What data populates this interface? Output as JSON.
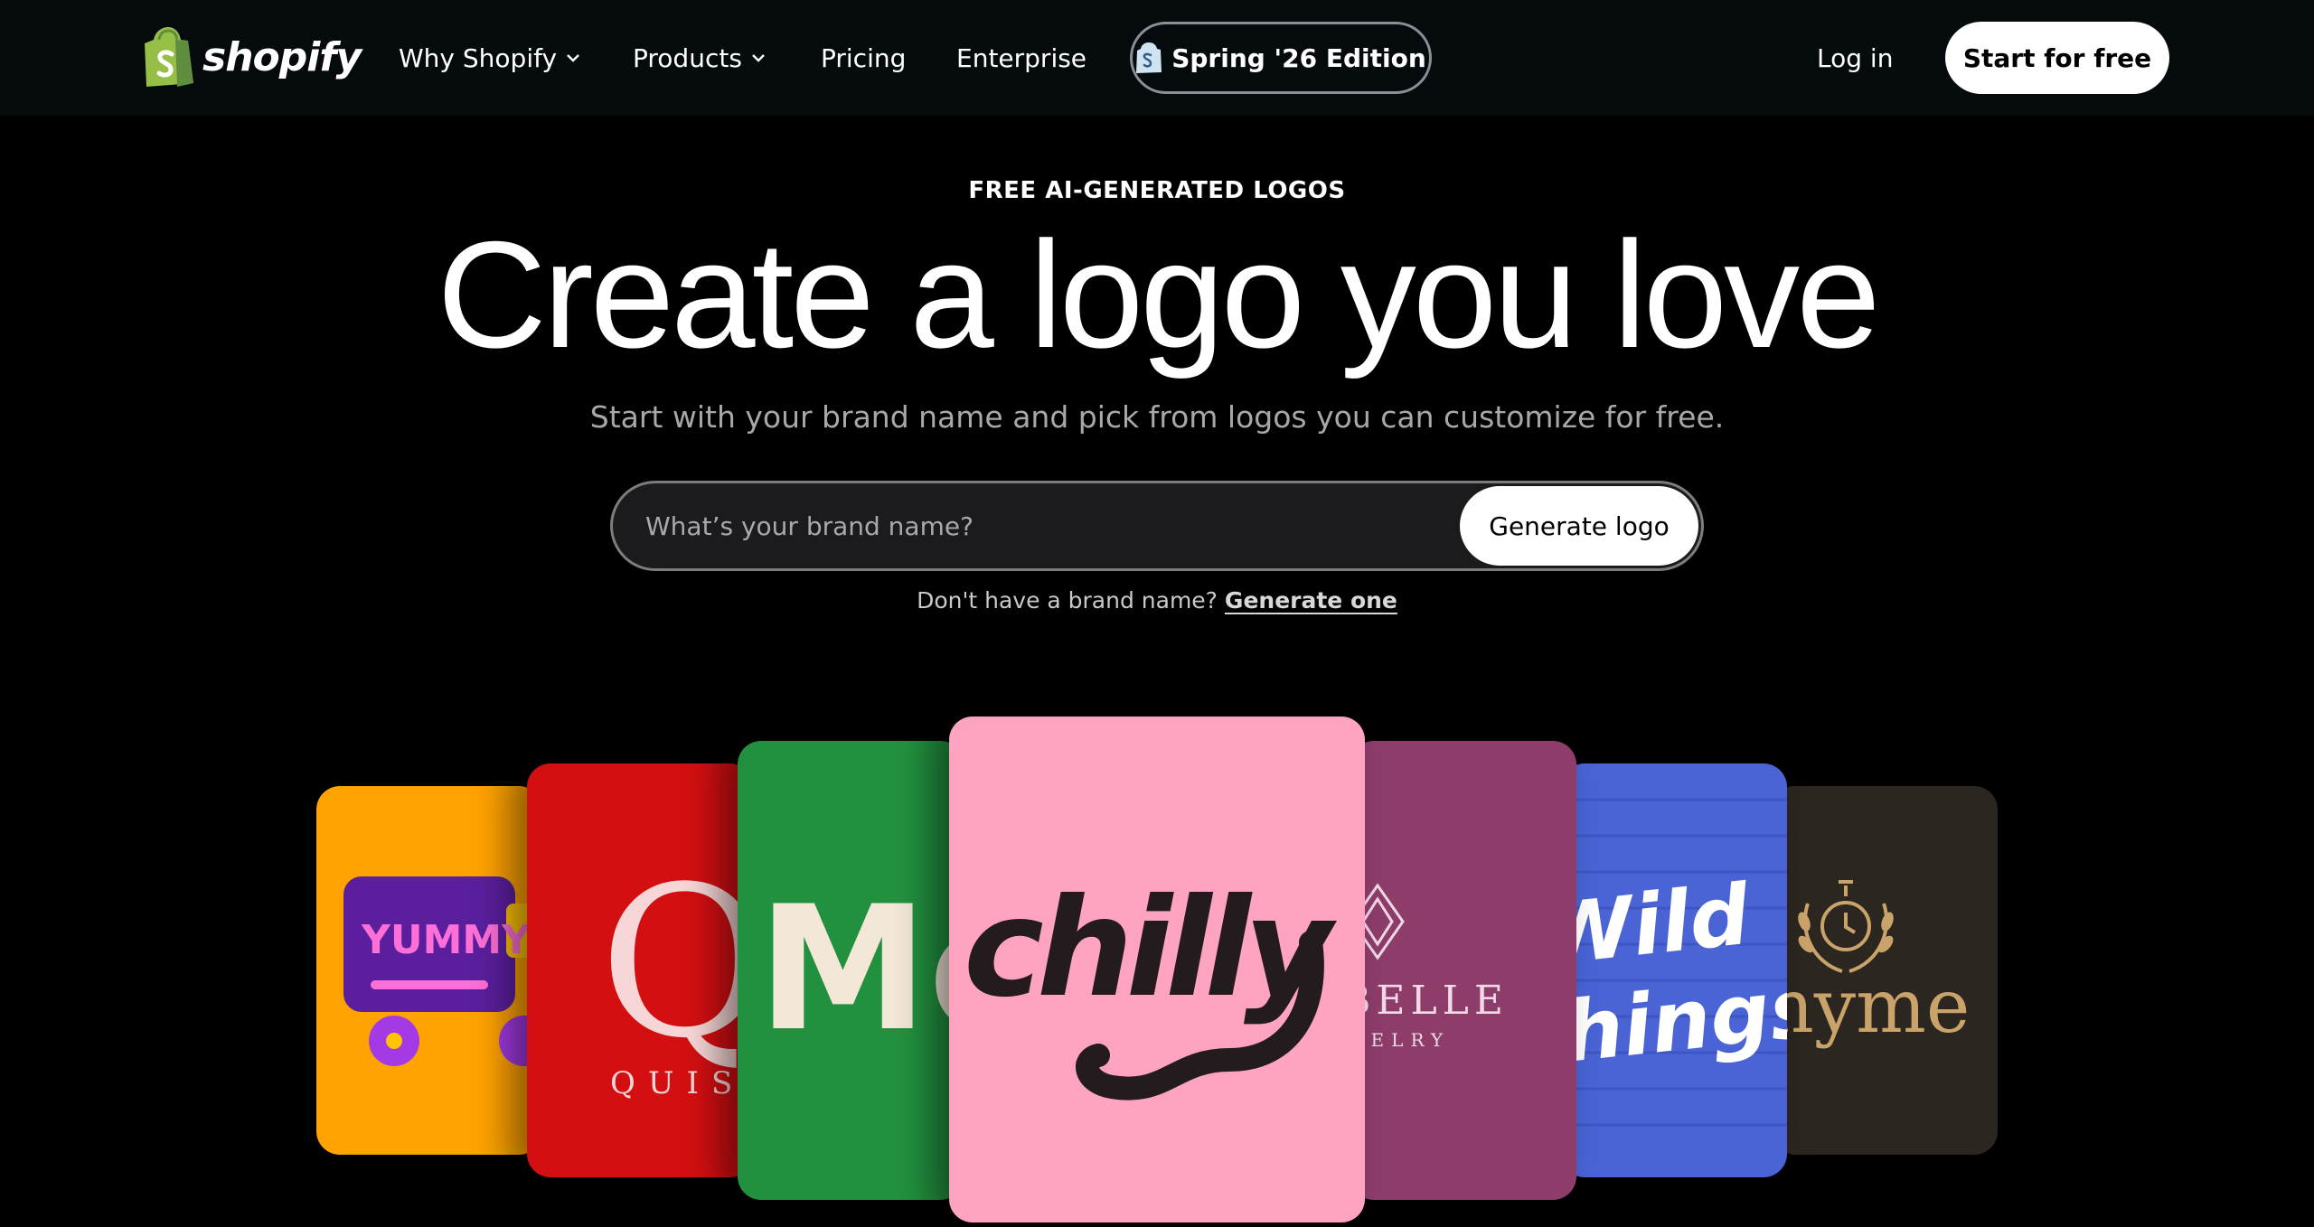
{
  "nav": {
    "brand": "shopify",
    "items": [
      {
        "label": "Why Shopify",
        "dropdown": true
      },
      {
        "label": "Products",
        "dropdown": true
      },
      {
        "label": "Pricing",
        "dropdown": false
      },
      {
        "label": "Enterprise",
        "dropdown": false
      }
    ],
    "edition_label": "Spring '26 Edition",
    "login_label": "Log in",
    "start_label": "Start for free"
  },
  "hero": {
    "eyebrow": "FREE AI-GENERATED LOGOS",
    "headline": "Create a logo you love",
    "subhead": "Start with your brand name and pick from logos you can customize for free.",
    "search_placeholder": "What’s your brand name?",
    "generate_button": "Generate logo",
    "helper_text": "Don't have a brand name?",
    "helper_link": "Generate one"
  },
  "examples": [
    {
      "name": "yummy",
      "text": "YUMMY",
      "bg": "#ffa300"
    },
    {
      "name": "quisi",
      "text": "Q",
      "subtext": "QUIS",
      "bg": "#d30f12"
    },
    {
      "name": "mo",
      "text": "Mo",
      "bg": "#22913f"
    },
    {
      "name": "chilly",
      "text": "chilly",
      "bg": "#ffa4c0"
    },
    {
      "name": "belle",
      "text": "BELLE",
      "subtext": "WELRY",
      "bg": "#8e3d6b"
    },
    {
      "name": "wild-things",
      "text": "Wild",
      "subtext": "things",
      "bg": "#4a64d6"
    },
    {
      "name": "nyme",
      "text": "nyme",
      "bg": "#241f1a"
    }
  ],
  "colors": {
    "nav_bg": "#050a0d",
    "page_bg": "#000000",
    "shopify_green": "#95bf47",
    "button_bg": "#ffffff"
  }
}
